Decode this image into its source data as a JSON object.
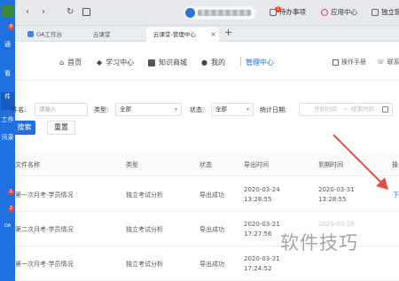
{
  "rail": {
    "items": [
      {
        "label": "通",
        "badge": "8"
      },
      {
        "label": "看"
      },
      {
        "label": "件"
      },
      {
        "label": "工作"
      },
      {
        "label": "讯录"
      }
    ],
    "lower_badges": [
      "1",
      "2"
    ],
    "lower_label": "OA"
  },
  "browser": {
    "tabs": [
      {
        "label": "OA工作台"
      },
      {
        "label": "云课堂"
      },
      {
        "label": "云课堂-管理中心",
        "close": "×"
      }
    ],
    "new_tab": "+",
    "toolbar": {
      "todo_label": "待办事项",
      "todo_badge": "1",
      "app_center": "应用中心",
      "standalone": "独立窗"
    }
  },
  "site_nav": {
    "items": [
      {
        "label": "首页",
        "icon": "home-icon"
      },
      {
        "label": "学习中心",
        "icon": "graduation-cap-icon"
      },
      {
        "label": "知识商城",
        "icon": "books-icon"
      },
      {
        "label": "我的",
        "icon": "user-icon"
      },
      {
        "label": "管理中心",
        "active": true
      }
    ],
    "manual": "操作手册",
    "contact": "联系"
  },
  "filters": {
    "name_label": "件名:",
    "name_placeholder": "请输入",
    "type_label": "类型:",
    "type_value": "全部",
    "status_label": "状态:",
    "status_value": "全部",
    "date_label": "统计日期:",
    "date_start": "开始时间",
    "date_sep": "~",
    "date_end": "结束时间",
    "search_button": "搜索",
    "reset_button": "重置"
  },
  "table": {
    "columns": [
      "文件名称",
      "类型",
      "状态",
      "导出时间",
      "到期时间",
      "操"
    ],
    "rows": [
      {
        "name": "第一次月考-学员情况",
        "type": "独立考试分析",
        "status": "导出成功",
        "export_date": "2020-03-24",
        "export_time": "13:28:55",
        "expire_date": "2020-03-31",
        "expire_time": "13:28:55",
        "action": "下"
      },
      {
        "name": "第二次月考-学员情况",
        "type": "独立考试分析",
        "status": "导出成功",
        "export_date": "2020-03-21",
        "export_time": "17:27:56",
        "expire_date": "2020-03-28",
        "expire_time": "",
        "action": ""
      },
      {
        "name": "第一次月考-学员情况",
        "type": "独立考试分析",
        "status": "导出成功",
        "export_date": "2020-03-21",
        "export_time": "17:24:52",
        "expire_date": "",
        "expire_time": "",
        "action": ""
      }
    ]
  },
  "watermark": "软件技巧",
  "colors": {
    "accent": "#1e6fe0",
    "arrow": "#e0504a"
  }
}
